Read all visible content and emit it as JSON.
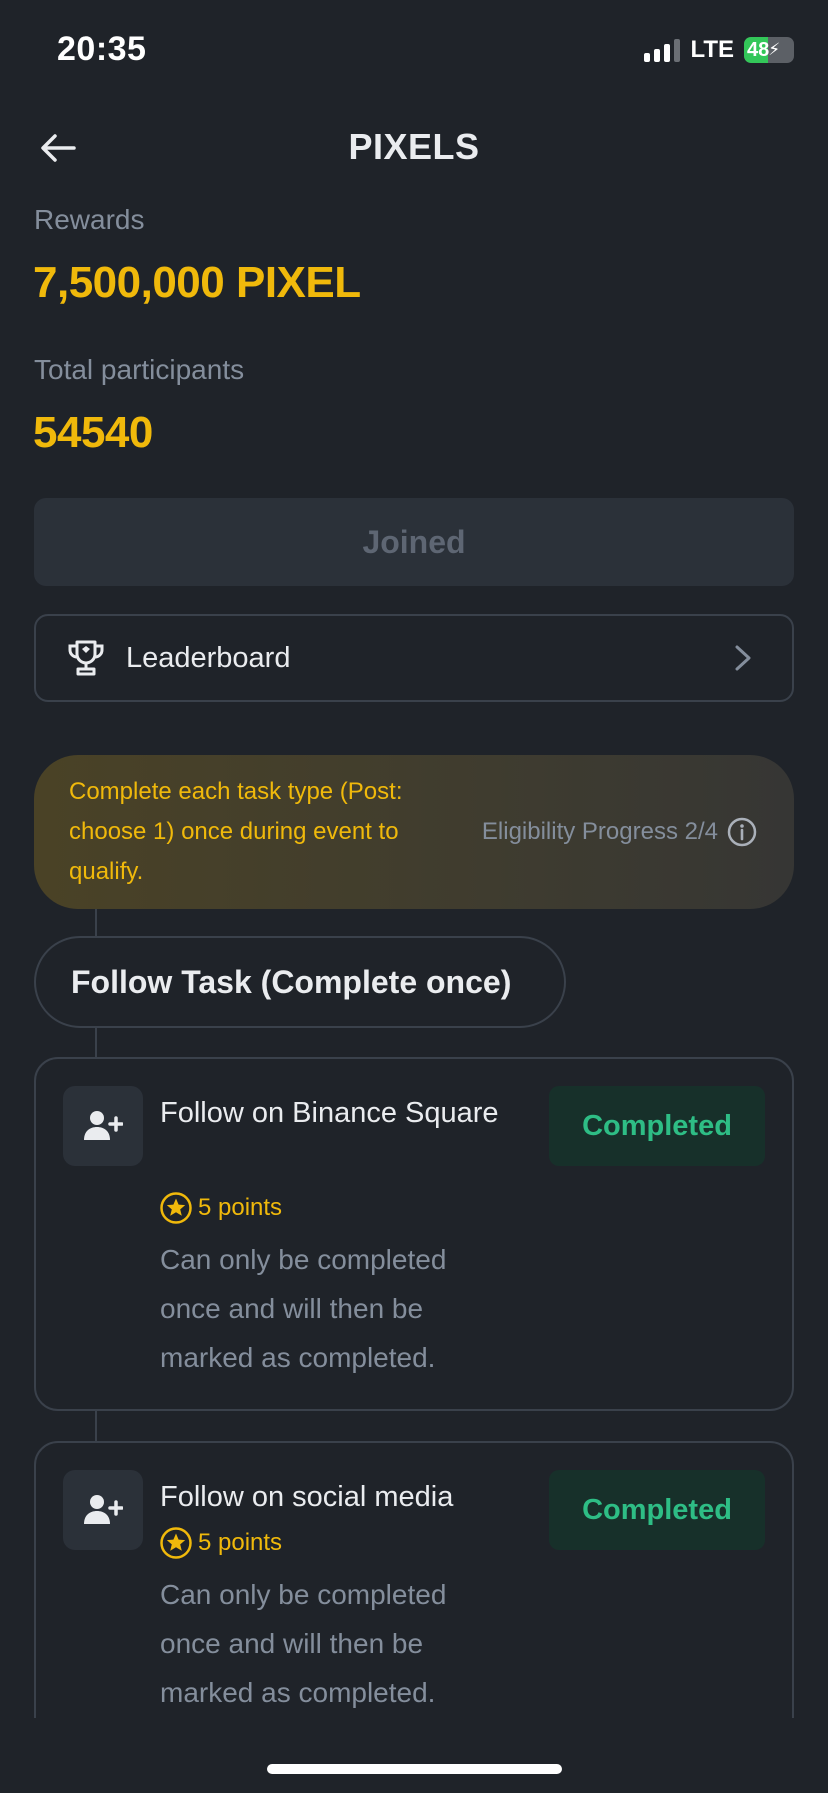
{
  "status_bar": {
    "time": "20:35",
    "network": "LTE",
    "battery": "48",
    "battery_level": 0.48
  },
  "header": {
    "title": "PIXELS"
  },
  "rewards": {
    "label": "Rewards",
    "value": "7,500,000 PIXEL"
  },
  "participants": {
    "label": "Total participants",
    "value": "54540"
  },
  "join_button": {
    "label": "Joined"
  },
  "leaderboard": {
    "label": "Leaderboard"
  },
  "notice": {
    "text": "Complete each task type (Post: choose 1) once during event to qualify.",
    "progress": "Eligibility Progress 2/4"
  },
  "task_group": {
    "title": "Follow Task (Complete once)"
  },
  "tasks": [
    {
      "title": "Follow on Binance Square",
      "points": "5 points",
      "description": "Can only be completed once and will then be marked as completed.",
      "status": "Completed"
    },
    {
      "title": "Follow on social media",
      "points": "5 points",
      "description": "Can only be completed once and will then be marked as completed.",
      "status": "Completed"
    }
  ],
  "colors": {
    "accent": "#f0b90b",
    "success": "#2ebd85",
    "background": "#1f2329",
    "muted": "#848e9c"
  },
  "icons": [
    "back-arrow-icon",
    "trophy-icon",
    "chevron-right-icon",
    "info-icon",
    "add-user-icon",
    "star-icon"
  ]
}
